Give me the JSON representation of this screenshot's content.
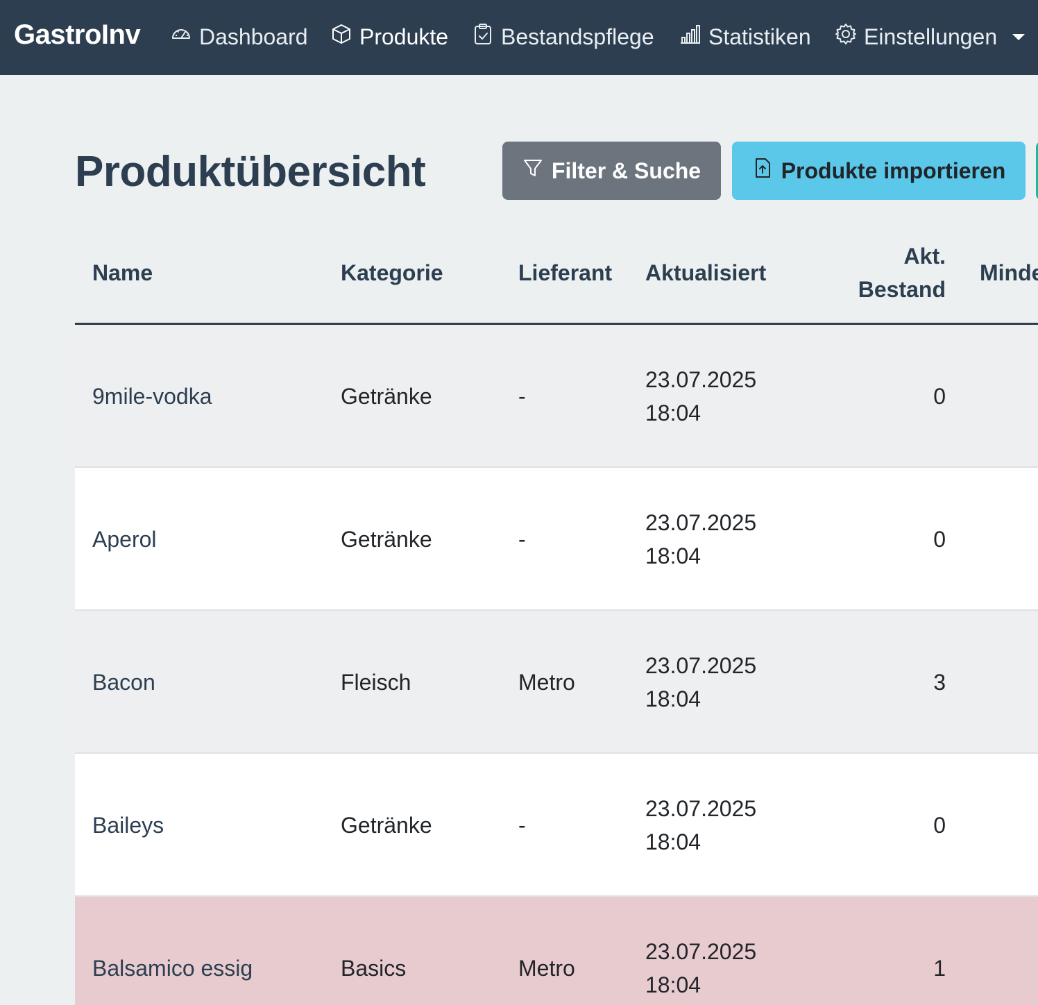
{
  "nav": {
    "brand": "GastroInv",
    "items": [
      {
        "label": "Dashboard",
        "icon": "speedometer-icon"
      },
      {
        "label": "Produkte",
        "icon": "box-icon"
      },
      {
        "label": "Bestandspflege",
        "icon": "clipboard-check-icon"
      },
      {
        "label": "Statistiken",
        "icon": "bar-chart-icon"
      },
      {
        "label": "Einstellungen",
        "icon": "gear-icon"
      }
    ]
  },
  "page": {
    "title": "Produktübersicht",
    "filter_button": "Filter & Suche",
    "import_button": "Produkte importieren"
  },
  "table": {
    "headers": {
      "name": "Name",
      "category": "Kategorie",
      "supplier": "Lieferant",
      "updated": "Aktualisiert",
      "stock_line1": "Akt.",
      "stock_line2": "Bestand",
      "min": "Minde"
    },
    "rows": [
      {
        "name": "9mile-vodka",
        "category": "Getränke",
        "supplier": "-",
        "updated_date": "23.07.2025",
        "updated_time": "18:04",
        "stock": "0"
      },
      {
        "name": "Aperol",
        "category": "Getränke",
        "supplier": "-",
        "updated_date": "23.07.2025",
        "updated_time": "18:04",
        "stock": "0"
      },
      {
        "name": "Bacon",
        "category": "Fleisch",
        "supplier": "Metro",
        "updated_date": "23.07.2025",
        "updated_time": "18:04",
        "stock": "3"
      },
      {
        "name": "Baileys",
        "category": "Getränke",
        "supplier": "-",
        "updated_date": "23.07.2025",
        "updated_time": "18:04",
        "stock": "0"
      },
      {
        "name": "Balsamico essig",
        "category": "Basics",
        "supplier": "Metro",
        "updated_date": "23.07.2025",
        "updated_time": "18:04",
        "stock": "1"
      }
    ]
  },
  "colors": {
    "navbar": "#2c3e50",
    "page_bg": "#ecf0f1",
    "filter_button": "#6c757d",
    "import_button": "#5bc8ea",
    "danger_row": "#e8cbcf"
  }
}
